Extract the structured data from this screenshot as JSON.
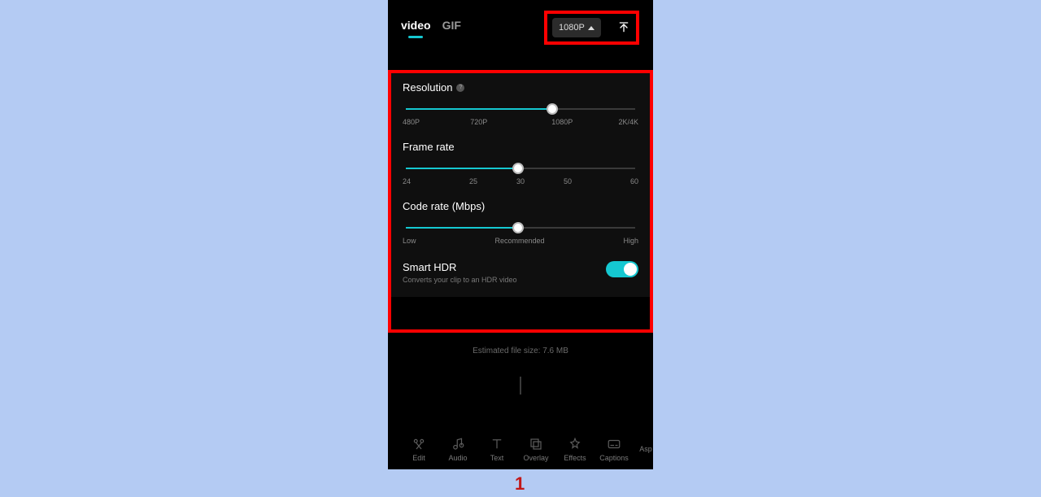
{
  "top": {
    "tab_video": "video",
    "tab_gif": "GIF",
    "resolution_button": "1080P"
  },
  "resolution": {
    "title": "Resolution",
    "ticks": [
      "480P",
      "720P",
      "1080P",
      "2K/4K"
    ],
    "fill_pct": 64
  },
  "framerate": {
    "title": "Frame rate",
    "ticks": [
      "24",
      "25",
      "30",
      "50",
      "60"
    ],
    "fill_pct": 49
  },
  "coderate": {
    "title": "Code rate (Mbps)",
    "ticks": [
      "Low",
      "Recommended",
      "High"
    ],
    "fill_pct": 49
  },
  "hdr": {
    "title": "Smart HDR",
    "subtitle": "Converts your clip to an HDR video"
  },
  "filesize": "Estimated file size: 7.6 MB",
  "bottom": {
    "edit": "Edit",
    "audio": "Audio",
    "text": "Text",
    "overlay": "Overlay",
    "effects": "Effects",
    "captions": "Captions",
    "aspect": "Asp"
  },
  "step": "1"
}
